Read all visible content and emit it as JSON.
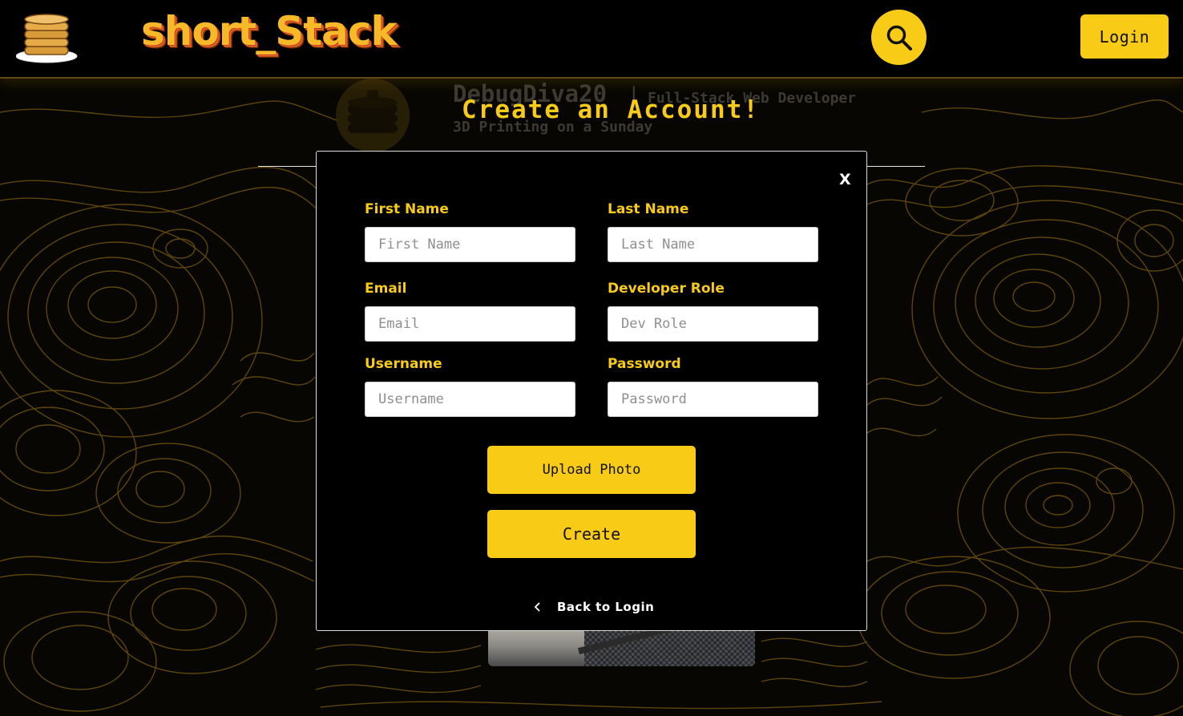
{
  "header": {
    "brand": "short_Stack",
    "login_label": "Login",
    "icons": {
      "logo": "pancake-stack-icon",
      "search": "search-icon"
    }
  },
  "background_profile": {
    "username": "DebugDiva20",
    "separator": "|",
    "role": "Full-Stack Web Developer",
    "bio": "3D Printing on a Sunday"
  },
  "modal": {
    "title": "Create an Account!",
    "close_label": "X",
    "fields": {
      "first_name": {
        "label": "First Name",
        "placeholder": "First Name"
      },
      "last_name": {
        "label": "Last Name",
        "placeholder": "Last Name"
      },
      "email": {
        "label": "Email",
        "placeholder": "Email"
      },
      "developer_role": {
        "label": "Developer Role",
        "placeholder": "Dev Role"
      },
      "username": {
        "label": "Username",
        "placeholder": "Username"
      },
      "password": {
        "label": "Password",
        "placeholder": "Password"
      }
    },
    "upload_label": "Upload Photo",
    "create_label": "Create",
    "back_label": "Back to Login"
  },
  "colors": {
    "accent": "#f8cb17",
    "background": "#070602",
    "contour": "#7a5a10",
    "modal_bg": "#000000",
    "modal_border": "#dcdcdc"
  }
}
